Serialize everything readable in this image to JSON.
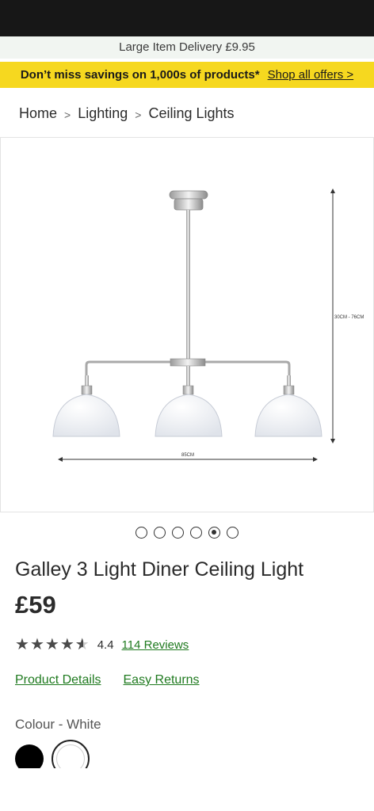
{
  "delivery": {
    "text": "Large Item Delivery £9.95"
  },
  "offer": {
    "text": "Don’t miss savings on 1,000s of products*",
    "link": "Shop all offers >"
  },
  "breadcrumb": {
    "items": [
      "Home",
      "Lighting",
      "Ceiling Lights"
    ]
  },
  "gallery": {
    "height_label": "30CM - 76CM",
    "width_label": "85CM",
    "slide_count": 6,
    "active_slide": 5
  },
  "product": {
    "title": "Galley 3 Light Diner Ceiling Light",
    "price": "£59"
  },
  "rating": {
    "value": "4.4",
    "reviews": "114 Reviews"
  },
  "tabs": {
    "details": "Product Details",
    "returns": "Easy Returns"
  },
  "colour": {
    "label": "Colour - White",
    "options": [
      "black",
      "white"
    ],
    "selected": "white"
  },
  "colors": {
    "banner": "#f6d81f",
    "link_green": "#1f7a1f",
    "status_bar": "#171717"
  }
}
